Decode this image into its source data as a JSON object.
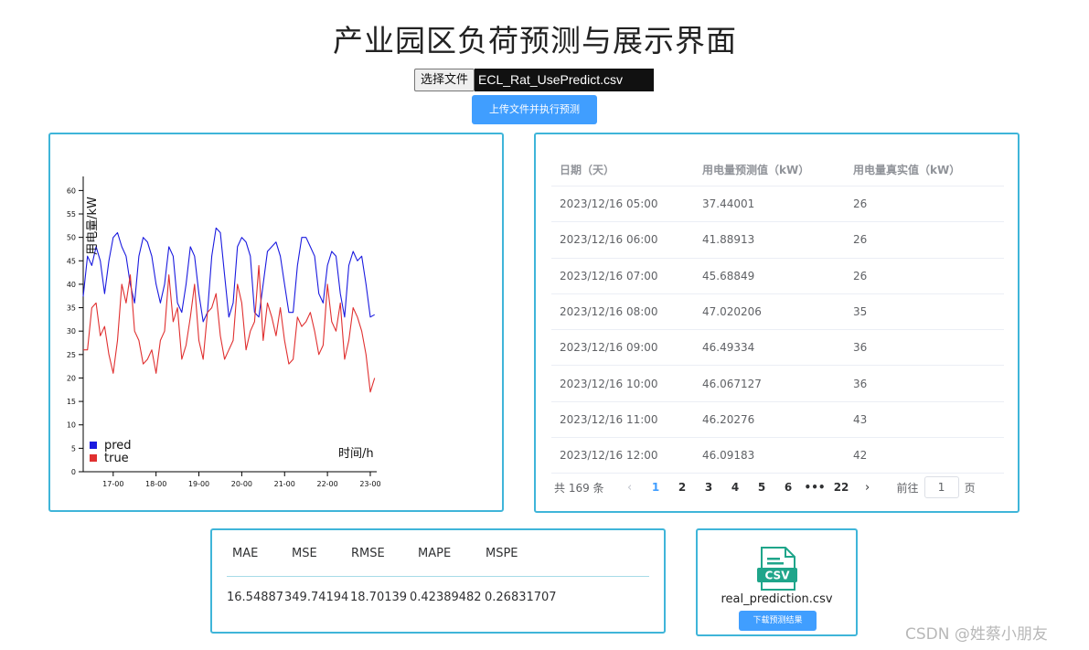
{
  "page": {
    "title": "产业园区负荷预测与展示界面",
    "watermark": "CSDN @姓蔡小朋友"
  },
  "upload": {
    "choose_label": "选择文件",
    "file_name": "ECL_Rat_UsePredict.csv",
    "submit_label": "上传文件并执行预测"
  },
  "chart_data": {
    "type": "line",
    "ylabel": "用电量/kW",
    "xlabel": "时间/h",
    "ylim": [
      0,
      63
    ],
    "y_ticks": [
      0,
      5,
      10,
      15,
      20,
      25,
      30,
      35,
      40,
      45,
      50,
      55,
      60
    ],
    "x_tick_labels": [
      "17-00",
      "18-00",
      "19-00",
      "20-00",
      "21-00",
      "22-00",
      "23-00"
    ],
    "x_range": [
      16.3,
      23.15
    ],
    "legend": "bottom-left",
    "series": [
      {
        "name": "pred",
        "color": "#1a1adf",
        "x": [
          16.3,
          16.4,
          16.5,
          16.6,
          16.7,
          16.8,
          16.9,
          17.0,
          17.1,
          17.2,
          17.3,
          17.4,
          17.5,
          17.6,
          17.7,
          17.8,
          17.9,
          18.0,
          18.1,
          18.2,
          18.3,
          18.4,
          18.5,
          18.6,
          18.7,
          18.8,
          18.9,
          19.0,
          19.1,
          19.2,
          19.3,
          19.4,
          19.5,
          19.6,
          19.7,
          19.8,
          19.9,
          20.0,
          20.1,
          20.2,
          20.3,
          20.4,
          20.5,
          20.6,
          20.7,
          20.8,
          20.9,
          21.0,
          21.1,
          21.2,
          21.3,
          21.4,
          21.5,
          21.6,
          21.7,
          21.8,
          21.9,
          22.0,
          22.1,
          22.2,
          22.3,
          22.4,
          22.5,
          22.6,
          22.7,
          22.8,
          22.9,
          23.0,
          23.1
        ],
        "y": [
          37.4,
          46,
          44,
          48,
          45,
          38,
          45,
          50,
          51,
          48,
          46,
          40,
          36,
          46,
          50,
          49,
          46,
          40,
          36,
          40,
          48,
          46,
          36,
          34,
          40,
          48,
          46,
          38,
          32,
          34,
          46,
          52,
          51,
          42,
          33,
          36,
          48,
          50,
          49,
          46,
          34,
          33,
          40,
          47,
          48,
          49,
          46,
          40,
          34,
          34,
          44,
          50,
          50,
          48,
          46,
          38,
          36,
          44,
          47,
          46,
          38,
          33,
          44,
          47,
          45,
          46,
          40,
          33,
          33.5
        ]
      },
      {
        "name": "true",
        "color": "#e03030",
        "x": [
          16.3,
          16.4,
          16.5,
          16.6,
          16.7,
          16.8,
          16.9,
          17.0,
          17.1,
          17.2,
          17.3,
          17.4,
          17.5,
          17.6,
          17.7,
          17.8,
          17.9,
          18.0,
          18.1,
          18.2,
          18.3,
          18.4,
          18.5,
          18.6,
          18.7,
          18.8,
          18.9,
          19.0,
          19.1,
          19.2,
          19.3,
          19.4,
          19.5,
          19.6,
          19.7,
          19.8,
          19.9,
          20.0,
          20.1,
          20.2,
          20.3,
          20.4,
          20.5,
          20.6,
          20.7,
          20.8,
          20.9,
          21.0,
          21.1,
          21.2,
          21.3,
          21.4,
          21.5,
          21.6,
          21.7,
          21.8,
          21.9,
          22.0,
          22.1,
          22.2,
          22.3,
          22.4,
          22.5,
          22.6,
          22.7,
          22.8,
          22.9,
          23.0,
          23.1
        ],
        "y": [
          26,
          26,
          35,
          36,
          29,
          31,
          25,
          21,
          28,
          40,
          36,
          42,
          30,
          28,
          23,
          24,
          26,
          21,
          28,
          30,
          42,
          32,
          35,
          24,
          27,
          33,
          40,
          28,
          24,
          34,
          35,
          38,
          29,
          24,
          26,
          28,
          40,
          36,
          26,
          30,
          32,
          44,
          28,
          36,
          33,
          29,
          35,
          28,
          23,
          24,
          33,
          31,
          32,
          34,
          30,
          25,
          27,
          40,
          32,
          30,
          36,
          24,
          28,
          35,
          33,
          30,
          25,
          17,
          20
        ]
      }
    ]
  },
  "table": {
    "headers": [
      "日期（天）",
      "用电量预测值（kW）",
      "用电量真实值（kW）"
    ],
    "rows": [
      [
        "2023/12/16 05:00",
        "37.44001",
        "26"
      ],
      [
        "2023/12/16 06:00",
        "41.88913",
        "26"
      ],
      [
        "2023/12/16 07:00",
        "45.68849",
        "26"
      ],
      [
        "2023/12/16 08:00",
        "47.020206",
        "35"
      ],
      [
        "2023/12/16 09:00",
        "46.49334",
        "36"
      ],
      [
        "2023/12/16 10:00",
        "46.067127",
        "36"
      ],
      [
        "2023/12/16 11:00",
        "46.20276",
        "43"
      ],
      [
        "2023/12/16 12:00",
        "46.09183",
        "42"
      ]
    ]
  },
  "pagination": {
    "total_text": "共 169 条",
    "prev": "‹",
    "pages": [
      "1",
      "2",
      "3",
      "4",
      "5",
      "6",
      "•••",
      "22"
    ],
    "next": "›",
    "goto_label": "前往",
    "goto_value": "1",
    "page_unit": "页"
  },
  "metrics": {
    "headers": [
      "MAE",
      "MSE",
      "RMSE",
      "MAPE",
      "MSPE"
    ],
    "values": [
      "16.54887",
      "349.74194",
      "18.70139",
      "0.42389482",
      "0.26831707"
    ]
  },
  "download": {
    "icon_text": "CSV",
    "file_name": "real_prediction.csv",
    "button_label": "下载预测结果"
  }
}
